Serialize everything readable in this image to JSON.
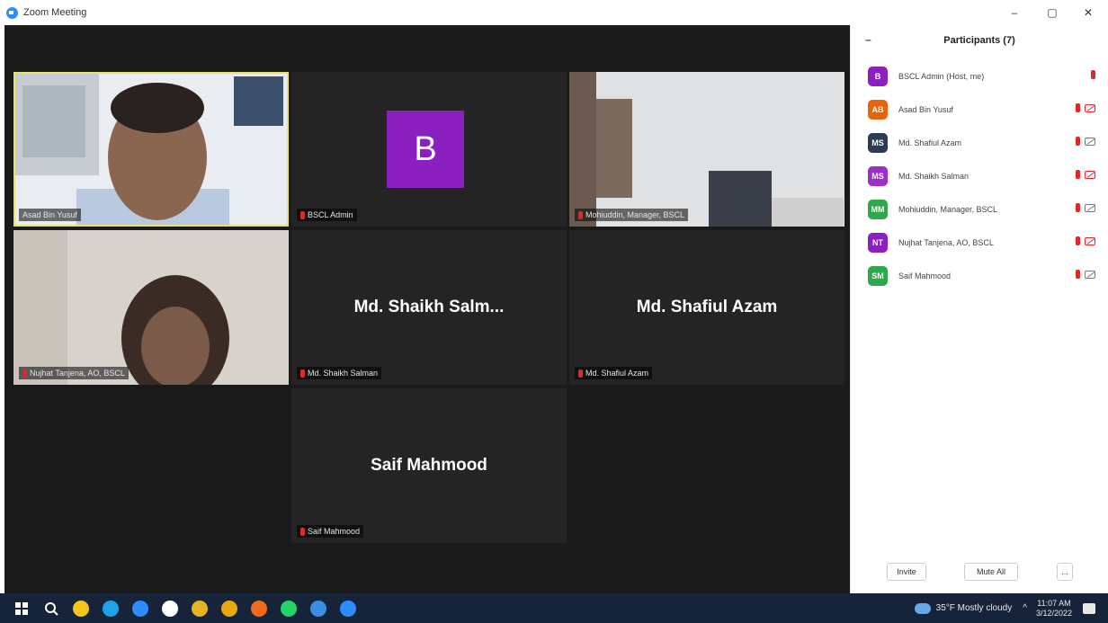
{
  "window": {
    "title": "Zoom Meeting",
    "min": "–",
    "max": "▢",
    "close": "✕"
  },
  "tiles": [
    {
      "label": "Asad Bin Yusuf",
      "type": "video",
      "active": true
    },
    {
      "label": "BSCL Admin",
      "type": "avatar",
      "avatar_letter": "B",
      "avatar_color": "#8b1fbf"
    },
    {
      "label": "Mohiuddin, Manager, BSCL",
      "type": "video"
    },
    {
      "label": "Nujhat Tanjena, AO, BSCL",
      "type": "video"
    },
    {
      "label": "Md. Shaikh Salman",
      "display_name": "Md. Shaikh Salm...",
      "type": "name"
    },
    {
      "label": "Md. Shafiul Azam",
      "display_name": "Md. Shafiul Azam",
      "type": "name"
    },
    {
      "label": "Saif Mahmood",
      "display_name": "Saif Mahmood",
      "type": "name"
    }
  ],
  "participants": {
    "title": "Participants (7)",
    "collapse": "–",
    "list": [
      {
        "initials": "B",
        "name": "BSCL Admin (Host, me)",
        "color": "#8b1fbf",
        "video": false
      },
      {
        "initials": "AB",
        "name": "Asad Bin Yusuf",
        "color": "#e8640c",
        "video": true
      },
      {
        "initials": "MS",
        "name": "Md. Shafiul Azam",
        "color": "#2f3b55",
        "video": true
      },
      {
        "initials": "MS",
        "name": "Md. Shaikh Salman",
        "color": "#9b2fc7",
        "video": true
      },
      {
        "initials": "MM",
        "name": "Mohiuddin, Manager, BSCL",
        "color": "#2ea84b",
        "video": true
      },
      {
        "initials": "NT",
        "name": "Nujhat Tanjena, AO, BSCL",
        "color": "#8b1fbf",
        "video": true
      },
      {
        "initials": "SM",
        "name": "Saif Mahmood",
        "color": "#2ea84b",
        "video": true
      }
    ],
    "invite": "Invite",
    "mute_all": "Mute All",
    "more": "..."
  },
  "taskbar": {
    "weather": "35°F  Mostly cloudy",
    "time": "11:07 AM",
    "date": "3/12/2022",
    "apps": [
      {
        "name": "windows-start-icon",
        "color": "#ffffff"
      },
      {
        "name": "search-icon",
        "color": "#ffffff"
      },
      {
        "name": "file-explorer-icon",
        "color": "#f5c518"
      },
      {
        "name": "edge-icon",
        "color": "#1fa3e8"
      },
      {
        "name": "store-icon",
        "color": "#2d8cff"
      },
      {
        "name": "whatsapp-icon",
        "color": "#ffffff"
      },
      {
        "name": "mail-icon",
        "color": "#e6b422"
      },
      {
        "name": "chrome-icon",
        "color": "#e8a90c"
      },
      {
        "name": "firefox-icon",
        "color": "#f26b1d"
      },
      {
        "name": "whatsapp-icon",
        "color": "#25d366"
      },
      {
        "name": "network-icon",
        "color": "#3a8ee6"
      },
      {
        "name": "zoom-icon",
        "color": "#2d8cff"
      }
    ]
  }
}
